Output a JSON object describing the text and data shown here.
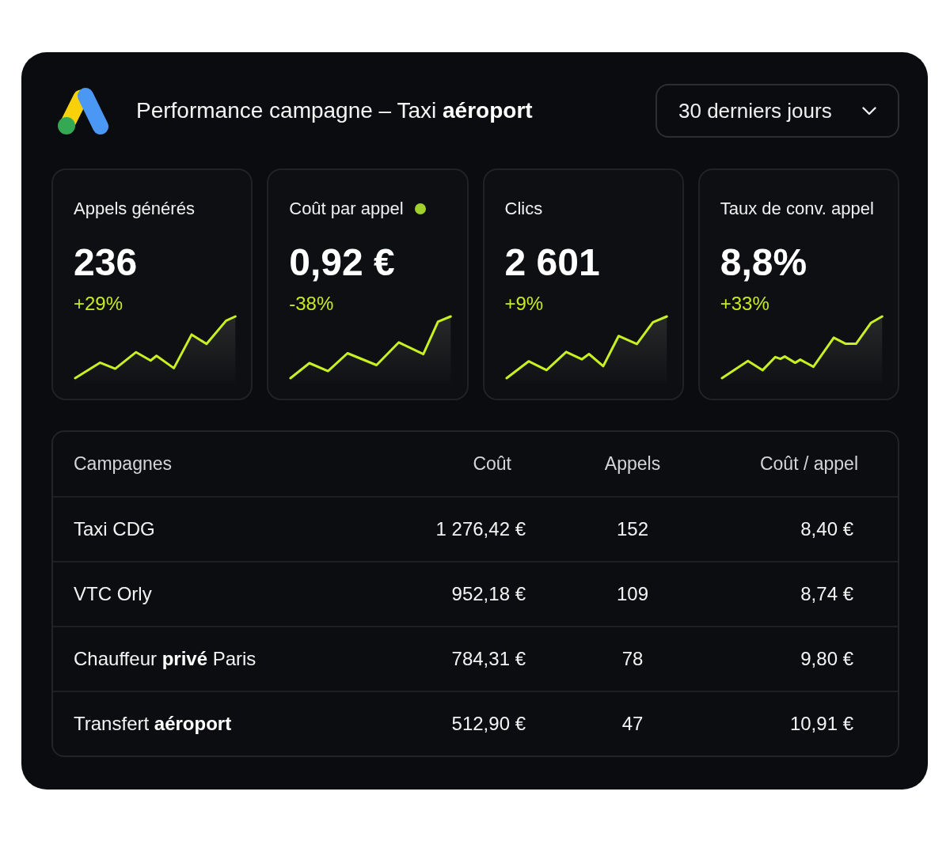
{
  "header": {
    "title": "Performance campagne – Taxi **aéroport**",
    "period_dropdown": {
      "value": "30 derniers jours"
    }
  },
  "metrics": [
    {
      "label": "Appels générés",
      "status_dot": false,
      "value": "236",
      "change": "+29%"
    },
    {
      "label": "Coût par appel",
      "status_dot": true,
      "value": "0,92 €",
      "change": "-38%"
    },
    {
      "label": "Clics",
      "status_dot": false,
      "value": "2 601",
      "change": "+9%"
    },
    {
      "label": "Taux de conv. appel",
      "status_dot": false,
      "value": "8,8%",
      "change": "+33%"
    }
  ],
  "table": {
    "columns": [
      "Campagnes",
      "Coût",
      "Appels",
      "Coût / appel"
    ],
    "rows": [
      [
        "Taxi CDG",
        "1 276,42 €",
        "152",
        "8,40 €"
      ],
      [
        "VTC Orly",
        "952,18 €",
        "109",
        "8,74 €"
      ],
      [
        "Chauffeur **privé** Paris",
        "784,31 €",
        "78",
        "9,80 €"
      ],
      [
        "Transfert **aéroport**",
        "512,90 €",
        "47",
        "10,91 €"
      ]
    ]
  }
}
